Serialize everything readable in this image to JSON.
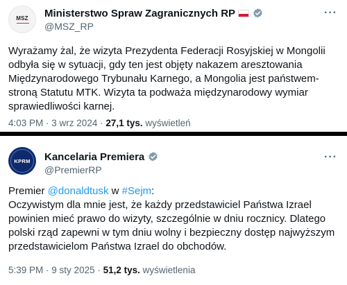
{
  "tweet1": {
    "avatar_text": "MSZ",
    "display_name": "Ministerstwo Spraw Zagranicznych RP",
    "handle": "@MSZ_RP",
    "more": "···",
    "lines": [
      "Wyrażamy żal, że wizyta Prezydenta Federacji Rosyjskiej w Mongolii",
      "odbyła się w sytuacji, gdy ten jest objęty nakazem aresztowania",
      "Międzynarodowego Trybunału Karnego, a Mongolia jest państwem-",
      "stroną Statutu MTK. Wizyta ta podważa międzynarodowy wymiar",
      "sprawiedliwości karnej."
    ],
    "time": "4:03 PM",
    "date": "3 wrz 2024",
    "views_count": "27,1 tys.",
    "views_label": "wyświetleń"
  },
  "tweet2": {
    "avatar_text": "KPRM",
    "display_name": "Kancelaria Premiera",
    "handle": "@PremierRP",
    "more": "···",
    "first_line": {
      "prefix": "Premier ",
      "mention": "@donaldtusk",
      "middle": " w ",
      "hashtag": "#Sejm",
      "suffix": ":"
    },
    "lines": [
      "Oczywistym dla mnie jest, że każdy przedstawiciel Państwa Izrael",
      "powinien mieć prawo do wizyty, szczególnie w dniu rocznicy. Dlatego",
      "polski rząd zapewni w tym dniu wolny i bezpieczny dostęp najwyższym",
      "przedstawicielom Państwa Izrael do obchodów."
    ],
    "time": "5:39 PM",
    "date": "9 sty 2025",
    "views_count": "51,2 tys.",
    "views_label": "wyświetlenia"
  },
  "colors": {
    "verified_badge": "#829aab",
    "link": "#1d9bf0",
    "secondary_text": "#536471",
    "divider": "#000000"
  },
  "icons": [
    "poland-flag-icon",
    "verified-badge-icon",
    "more-options-icon"
  ]
}
